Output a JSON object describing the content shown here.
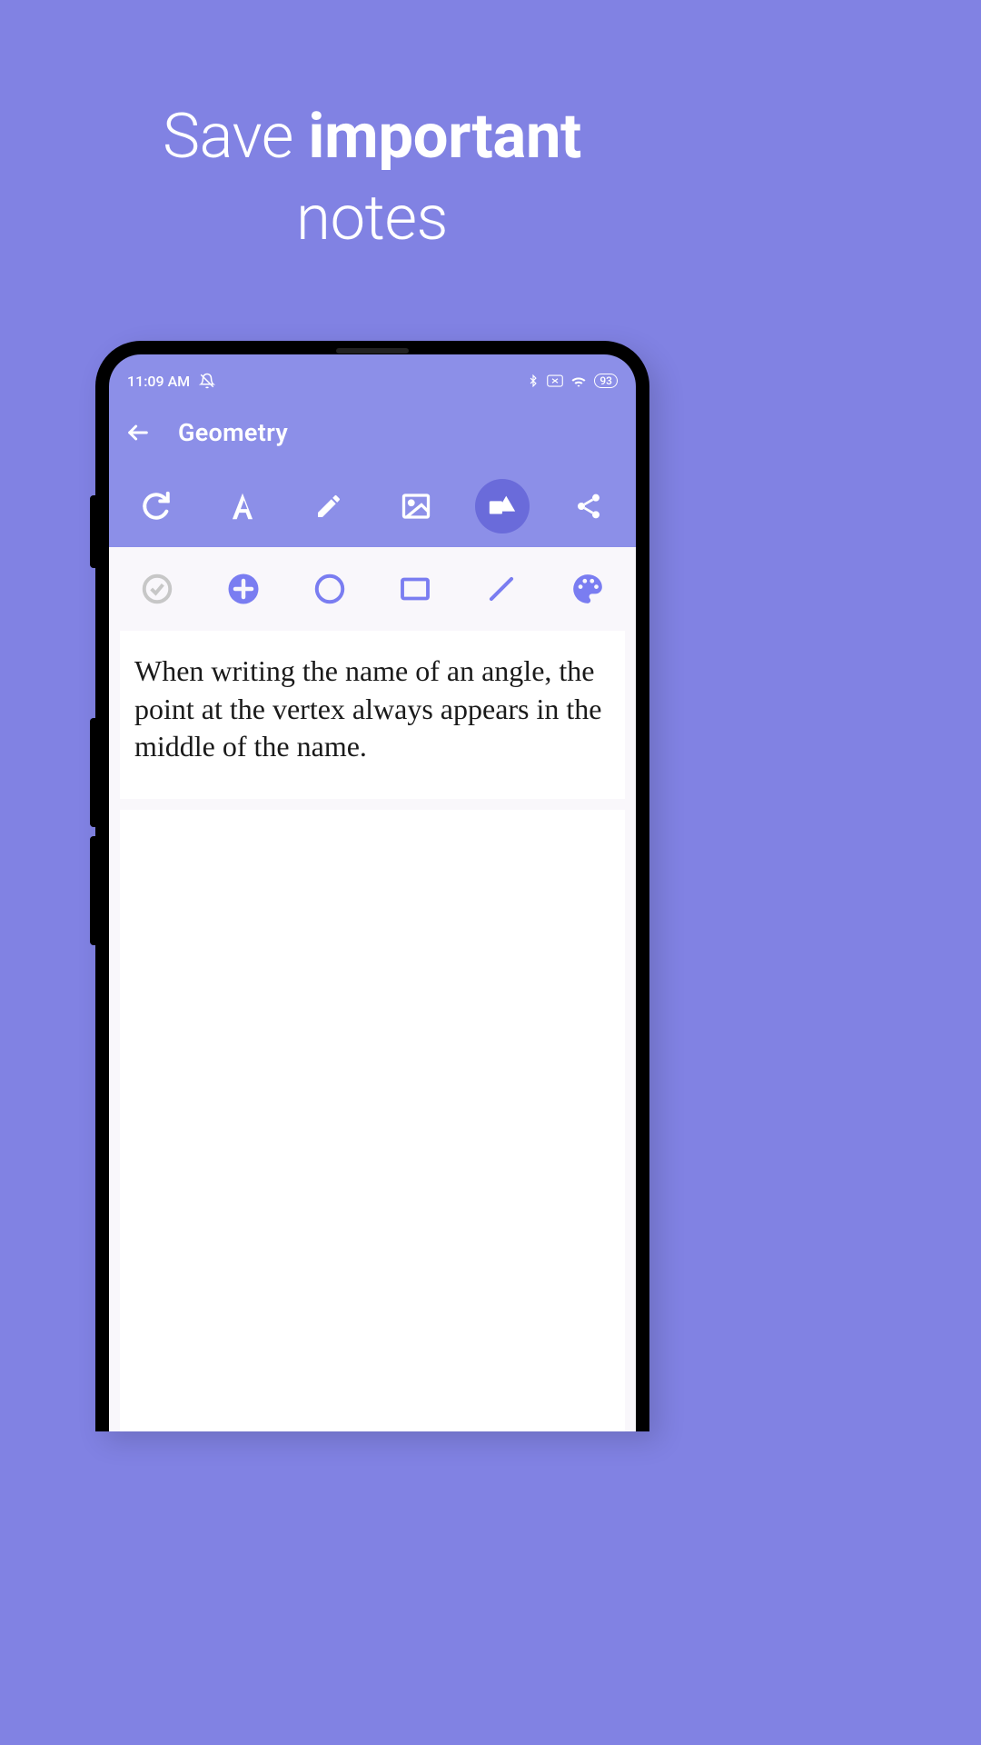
{
  "headline": {
    "before": "Save ",
    "bold": "important",
    "after": " notes"
  },
  "statusbar": {
    "time": "11:09 AM",
    "battery": "93"
  },
  "appbar": {
    "title": "Geometry"
  },
  "note": {
    "text": "When writing the name of an angle, the point at the vertex always appears in the middle of the name."
  }
}
